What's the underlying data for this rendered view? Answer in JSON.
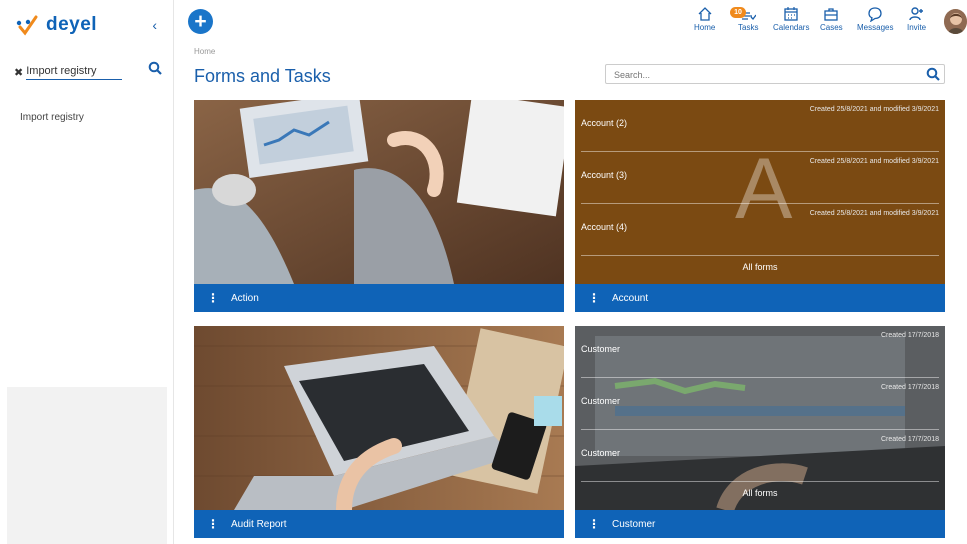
{
  "logo": {
    "text": "deyel"
  },
  "sidebar": {
    "search_value": "Import registry",
    "results": [
      "Import registry"
    ]
  },
  "nav": [
    {
      "label": "Home",
      "icon": "home-icon"
    },
    {
      "label": "Tasks",
      "icon": "tasks-icon",
      "badge": "10"
    },
    {
      "label": "Calendars",
      "icon": "calendar-icon"
    },
    {
      "label": "Cases",
      "icon": "briefcase-icon"
    },
    {
      "label": "Messages",
      "icon": "chat-icon"
    },
    {
      "label": "Invite",
      "icon": "invite-icon"
    }
  ],
  "breadcrumb": "Home",
  "page_title": "Forms and Tasks",
  "search_placeholder": "Search...",
  "cards": [
    {
      "title": "Action"
    },
    {
      "title": "Account",
      "letter": "A",
      "rows": [
        {
          "name": "Account (2)",
          "meta": "Created 25/8/2021 and modified 3/9/2021"
        },
        {
          "name": "Account (3)",
          "meta": "Created 25/8/2021 and modified 3/9/2021"
        },
        {
          "name": "Account (4)",
          "meta": "Created 25/8/2021 and modified 3/9/2021"
        }
      ],
      "all_forms": "All forms"
    },
    {
      "title": "Audit Report"
    },
    {
      "title": "Customer",
      "rows": [
        {
          "name": "Customer",
          "meta": "Created 17/7/2018"
        },
        {
          "name": "Customer",
          "meta": "Created 17/7/2018"
        },
        {
          "name": "Customer",
          "meta": "Created 17/7/2018"
        }
      ],
      "all_forms": "All forms"
    }
  ],
  "colors": {
    "primary": "#0f63b7",
    "accent": "#f08a1c",
    "account_bg": "#7b4a12"
  }
}
